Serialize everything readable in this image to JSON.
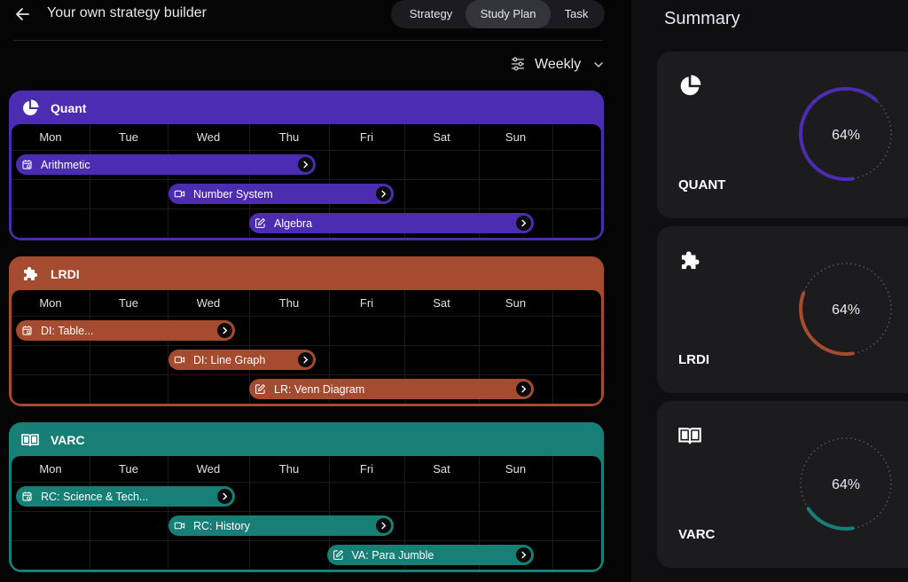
{
  "header": {
    "title": "Your own strategy builder",
    "tabs": [
      "Strategy",
      "Study Plan",
      "Task"
    ]
  },
  "period": {
    "label": "Weekly"
  },
  "days": [
    "Mon",
    "Tue",
    "Wed",
    "Thu",
    "Fri",
    "Sat",
    "Sun"
  ],
  "blocks": [
    {
      "name": "Quant",
      "color": "#4c2cb0",
      "icon": "pie-chart-icon",
      "tasks": [
        {
          "label": "Arithmetic",
          "icon": "calendar-icon",
          "start_day": "Mon",
          "end_day": "Thu"
        },
        {
          "label": "Number System",
          "icon": "video-icon",
          "start_day": "Wed",
          "end_day": "Fri"
        },
        {
          "label": "Algebra",
          "icon": "edit-icon",
          "start_day": "Thu",
          "end_day": "Sun"
        }
      ]
    },
    {
      "name": "LRDI",
      "color": "#a44b30",
      "icon": "puzzle-icon",
      "tasks": [
        {
          "label": "DI: Table...",
          "icon": "calendar-icon",
          "start_day": "Mon",
          "end_day": "Wed"
        },
        {
          "label": "DI: Line Graph",
          "icon": "video-icon",
          "start_day": "Wed",
          "end_day": "Thu"
        },
        {
          "label": "LR: Venn Diagram",
          "icon": "edit-icon",
          "start_day": "Thu",
          "end_day": "Sun"
        }
      ]
    },
    {
      "name": "VARC",
      "color": "#177f76",
      "icon": "book-icon",
      "tasks": [
        {
          "label": "RC: Science & Tech...",
          "icon": "calendar-icon",
          "start_day": "Mon",
          "end_day": "Wed"
        },
        {
          "label": "RC: History",
          "icon": "video-icon",
          "start_day": "Wed",
          "end_day": "Fri"
        },
        {
          "label": "VA: Para Jumble",
          "icon": "edit-icon",
          "start_day": "Fri",
          "end_day": "Sun"
        }
      ]
    }
  ],
  "summary": {
    "title": "Summary",
    "cards": [
      {
        "name": "QUANT",
        "percent_label": "64%",
        "progress": 0.64,
        "color": "#4c2cb0",
        "icon": "pie-chart-icon"
      },
      {
        "name": "LRDI",
        "percent_label": "64%",
        "progress": 0.33,
        "color": "#a44b30",
        "icon": "puzzle-icon"
      },
      {
        "name": "VARC",
        "percent_label": "64%",
        "progress": 0.18,
        "color": "#177f76",
        "icon": "book-icon"
      }
    ]
  }
}
